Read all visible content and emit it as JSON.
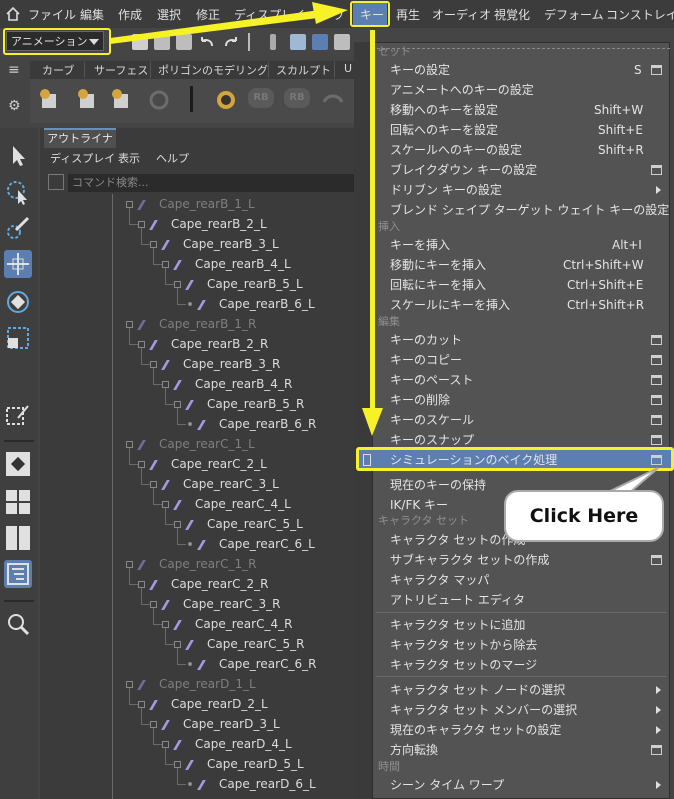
{
  "menubar": {
    "items": [
      "ファイル",
      "編集",
      "作成",
      "選択",
      "修正",
      "ディスプレイ",
      "ウ",
      "キー",
      "再生",
      "オーディオ",
      "視覚化",
      "デフォーム",
      "コンストレイント"
    ]
  },
  "toolbar": {
    "mode_selector": "アニメーション"
  },
  "shelf": {
    "tabs": [
      "カーブ",
      "サーフェス",
      "ポリゴンのモデリング",
      "スカルプト",
      "U"
    ]
  },
  "outliner": {
    "tab": "アウトライナ",
    "menus": [
      "ディスプレイ",
      "表示",
      "ヘルプ"
    ],
    "search_placeholder": "コマンド検索...",
    "rows": [
      {
        "label": "Cape_rearB_1_L",
        "depth": 0,
        "dim": true
      },
      {
        "label": "Cape_rearB_2_L",
        "depth": 1,
        "dim": false
      },
      {
        "label": "Cape_rearB_3_L",
        "depth": 2,
        "dim": false
      },
      {
        "label": "Cape_rearB_4_L",
        "depth": 3,
        "dim": false
      },
      {
        "label": "Cape_rearB_5_L",
        "depth": 4,
        "dim": false
      },
      {
        "label": "Cape_rearB_6_L",
        "depth": 5,
        "dim": false
      },
      {
        "label": "Cape_rearB_1_R",
        "depth": 0,
        "dim": true
      },
      {
        "label": "Cape_rearB_2_R",
        "depth": 1,
        "dim": false
      },
      {
        "label": "Cape_rearB_3_R",
        "depth": 2,
        "dim": false
      },
      {
        "label": "Cape_rearB_4_R",
        "depth": 3,
        "dim": false
      },
      {
        "label": "Cape_rearB_5_R",
        "depth": 4,
        "dim": false
      },
      {
        "label": "Cape_rearB_6_R",
        "depth": 5,
        "dim": false
      },
      {
        "label": "Cape_rearC_1_L",
        "depth": 0,
        "dim": true
      },
      {
        "label": "Cape_rearC_2_L",
        "depth": 1,
        "dim": false
      },
      {
        "label": "Cape_rearC_3_L",
        "depth": 2,
        "dim": false
      },
      {
        "label": "Cape_rearC_4_L",
        "depth": 3,
        "dim": false
      },
      {
        "label": "Cape_rearC_5_L",
        "depth": 4,
        "dim": false
      },
      {
        "label": "Cape_rearC_6_L",
        "depth": 5,
        "dim": false
      },
      {
        "label": "Cape_rearC_1_R",
        "depth": 0,
        "dim": true
      },
      {
        "label": "Cape_rearC_2_R",
        "depth": 1,
        "dim": false
      },
      {
        "label": "Cape_rearC_3_R",
        "depth": 2,
        "dim": false
      },
      {
        "label": "Cape_rearC_4_R",
        "depth": 3,
        "dim": false
      },
      {
        "label": "Cape_rearC_5_R",
        "depth": 4,
        "dim": false
      },
      {
        "label": "Cape_rearC_6_R",
        "depth": 5,
        "dim": false
      },
      {
        "label": "Cape_rearD_1_L",
        "depth": 0,
        "dim": true
      },
      {
        "label": "Cape_rearD_2_L",
        "depth": 1,
        "dim": false
      },
      {
        "label": "Cape_rearD_3_L",
        "depth": 2,
        "dim": false
      },
      {
        "label": "Cape_rearD_4_L",
        "depth": 3,
        "dim": false
      },
      {
        "label": "Cape_rearD_5_L",
        "depth": 4,
        "dim": false
      },
      {
        "label": "Cape_rearD_6_L",
        "depth": 5,
        "dim": false
      }
    ]
  },
  "key_menu": {
    "section_set": "セット",
    "set_key": "キーの設定",
    "set_key_shortcut": "S",
    "set_anim_key": "アニメートへのキーの設定",
    "set_translate_key": "移動へのキーを設定",
    "set_translate_key_shortcut": "Shift+W",
    "set_rotate_key": "回転へのキーを設定",
    "set_rotate_key_shortcut": "Shift+E",
    "set_scale_key": "スケールへのキーの設定",
    "set_scale_key_shortcut": "Shift+R",
    "set_breakdown_key": "ブレイクダウン キーの設定",
    "set_driven_key": "ドリブン キーの設定",
    "set_blendshape_key": "ブレンド シェイプ ターゲット ウェイト キーの設定",
    "section_insert": "挿入",
    "insert_key": "キーを挿入",
    "insert_key_shortcut": "Alt+I",
    "insert_translate_key": "移動にキーを挿入",
    "insert_translate_key_shortcut": "Ctrl+Shift+W",
    "insert_rotate_key": "回転にキーを挿入",
    "insert_rotate_key_shortcut": "Ctrl+Shift+E",
    "insert_scale_key": "スケールにキーを挿入",
    "insert_scale_key_shortcut": "Ctrl+Shift+R",
    "section_edit": "編集",
    "cut_keys": "キーのカット",
    "copy_keys": "キーのコピー",
    "paste_keys": "キーのペースト",
    "delete_keys": "キーの削除",
    "scale_keys": "キーのスケール",
    "snap_keys": "キーのスナップ",
    "bake_simulation": "シミュレーションのベイク処理",
    "hold_current_keys": "現在のキーの保持",
    "ik_fk_keys": "IK/FK キー",
    "section_charset": "キャラクタ セット",
    "create_charset": "キャラクタ セットの作成",
    "create_subcharset": "サブキャラクタ セットの作成",
    "character_mapper": "キャラクタ マッパ",
    "attribute_editor": "アトリビュート エディタ",
    "add_to_charset": "キャラクタ セットに追加",
    "remove_from_charset": "キャラクタ セットから除去",
    "merge_charset": "キャラクタ セットのマージ",
    "select_charset_node": "キャラクタ セット ノードの選択",
    "select_charset_members": "キャラクタ セット メンバーの選択",
    "set_current_charset": "現在のキャラクタ セットの設定",
    "redirect": "方向転換",
    "section_time": "時間",
    "scene_time_warp": "シーン タイム ワープ"
  },
  "callout": {
    "text": "Click Here"
  },
  "colors": {
    "highlight": "#f7f127",
    "selection": "#5b7fb0",
    "joint": "#a59ae0"
  }
}
